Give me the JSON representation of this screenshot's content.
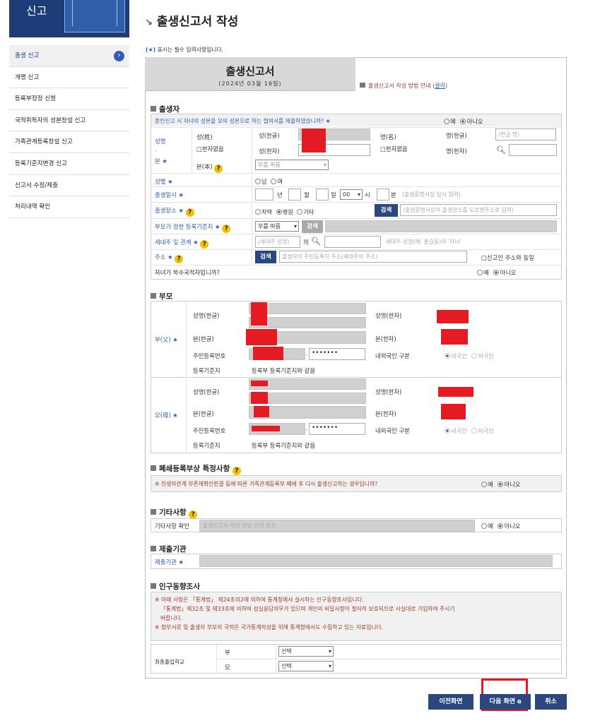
{
  "logo": {
    "text": "신고"
  },
  "sidebar": {
    "items": [
      {
        "label": "출생 신고",
        "active": true
      },
      {
        "label": "개명 신고"
      },
      {
        "label": "등록부정정 신청"
      },
      {
        "label": "국적취득자의 성본창설 신고"
      },
      {
        "label": "가족관계등록창설 신고"
      },
      {
        "label": "등록기준지변경 신고"
      },
      {
        "label": "신고서 수정/제출"
      },
      {
        "label": "처리내역 확인"
      }
    ]
  },
  "page": {
    "title": "출생신고서 작성",
    "required_note_mark": "(★)",
    "required_note": "표시는 필수 입력사항입니다."
  },
  "form": {
    "title": "출생신고서",
    "date": "(2024년 03월 16일)",
    "guide_prefix": "출생신고서 작성 방법 안내 (",
    "guide_link": "클릭",
    "guide_suffix": ")"
  },
  "child": {
    "section": "출생자",
    "q_marriage": "혼인신고 시 자녀의 성본을 모의 성본으로 하는 협의서를 제출하였습니까? ★",
    "yes": "예",
    "no": "아니오",
    "name_label": "성명 · 본 ★",
    "surname": "성(姓)",
    "no_hanja": "□한자없음",
    "given": "명(名)",
    "surname_hangul": "성(한글)",
    "surname_hanja": "성(한자)",
    "given_hangul": "명(한글)",
    "given_hanja": "명(한자)",
    "given_hangul_ph": "(한글 명)",
    "bon": "본(本)",
    "bon_select": "부를 따름",
    "sex_label": "성별 ★",
    "male": "남",
    "female": "여",
    "birth_label": "출생일시 ★",
    "year": "년",
    "month": "월",
    "day": "일",
    "hour_select": "00",
    "hour": "시",
    "minute": "분",
    "birth_ph": "(출생증명서상 일시 입력)",
    "place_label": "출생장소 ★",
    "home": "자택",
    "hospital": "병원",
    "etc": "기타",
    "search": "검색",
    "place_ph": "(출생증명서상의 출생장소를 도로명주소로 입력)",
    "regbase_label": "부모가 정한 등록기준지 ★",
    "regbase_select": "부를 따름",
    "householder_label": "세대주 및 관계 ★",
    "householder_ph": "(세대주 성명)",
    "of": "의",
    "relation_ph": "세대주 성명(예: 홍길동)의 '자녀'",
    "address_label": "주소 ★",
    "address_ph": "출생자의 주민등록지 주소(세대주의 주소)",
    "same_as_reporter": "□신고인 주소와 동일",
    "multi_nat_q": "자녀가 복수국적자입니까?"
  },
  "parents": {
    "section": "부모",
    "father_label": "부(父) ★",
    "mother_label": "모(母) ★",
    "name_hangul": "성명(한글)",
    "name_hanja": "성명(한자)",
    "bon_hangul": "본(한글)",
    "bon_hanja": "본(한자)",
    "rrn": "주민등록번호",
    "rrn_mask": "•••••••",
    "nationality": "내외국인 구분",
    "korean": "내국인",
    "foreign": "외국인",
    "regbase": "등록기준지",
    "regbase_value": "등록부 등록기준지와 같음"
  },
  "closure": {
    "section": "폐쇄등록부상 특정사항",
    "question": "※ 친생자관계 부존재확인판결 등에 따른 가족관계등록부 폐쇄 후 다시 출생신고하는 경우입니까?"
  },
  "other": {
    "section": "기타사항",
    "label": "기타사항 확인",
    "placeholder": "출생신고서 작성 방법 안내 참조"
  },
  "agency": {
    "section": "제출기관",
    "label": "제출기관 ★"
  },
  "survey": {
    "section": "인구동향조사",
    "note1": "※ 아래 사항은 「통계법」 제24조의2에 의하여 통계청에서 실시하는 인구동향조사입니다.",
    "note2": "「통계법」제32조 및 제33조에 의하여 성실응답의무가 있으며 개인의 비밀사항이 철저히 보호되므로 사실대로 기입하여 주시기",
    "note3": "바랍니다.",
    "note4": "※ 첨부서류 및 출생자 부모의 국적은 국가통계작성을 위해 통계청에서도 수집하고 있는 자료입니다.",
    "edu_label": "최종졸업학교",
    "father": "부",
    "mother": "모",
    "select": "선택"
  },
  "footer": {
    "prev": "이전화면",
    "next": "다음 화면",
    "cancel": "취소"
  }
}
